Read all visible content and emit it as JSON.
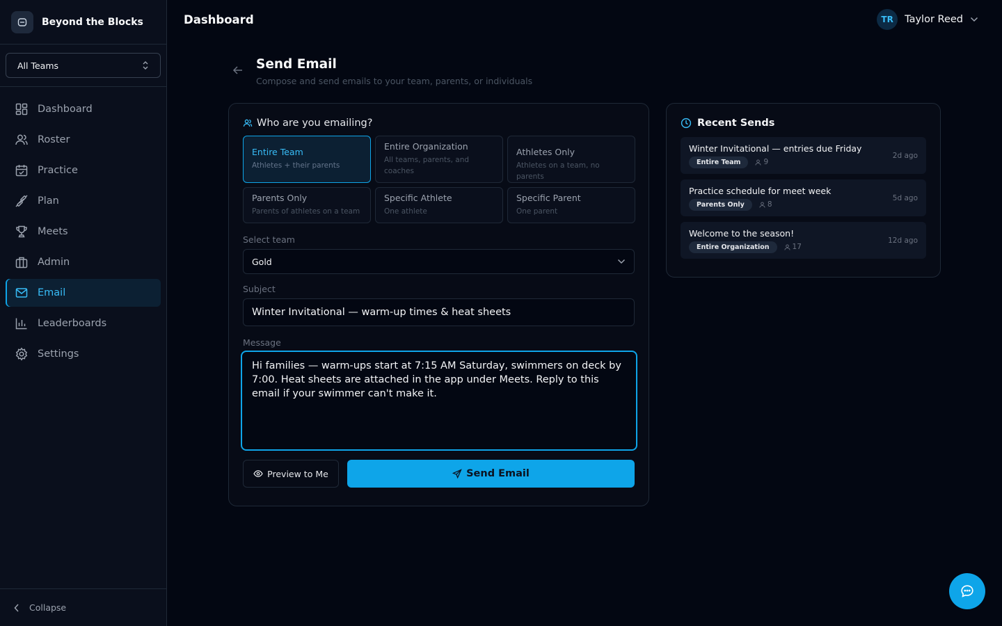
{
  "brand": {
    "name": "Beyond the Blocks"
  },
  "team_selector": {
    "value": "All Teams"
  },
  "sidebar": {
    "items": [
      {
        "label": "Dashboard",
        "icon": "dashboard-icon",
        "active": false
      },
      {
        "label": "Roster",
        "icon": "users-icon",
        "active": false
      },
      {
        "label": "Practice",
        "icon": "calendar-icon",
        "active": false
      },
      {
        "label": "Plan",
        "icon": "dumbbell-icon",
        "active": false
      },
      {
        "label": "Meets",
        "icon": "trophy-icon",
        "active": false
      },
      {
        "label": "Admin",
        "icon": "building-icon",
        "active": false
      },
      {
        "label": "Email",
        "icon": "mail-icon",
        "active": true
      },
      {
        "label": "Leaderboards",
        "icon": "bar-chart-icon",
        "active": false
      },
      {
        "label": "Settings",
        "icon": "gear-icon",
        "active": false
      }
    ],
    "collapse_label": "Collapse"
  },
  "header": {
    "title": "Dashboard",
    "user": {
      "initials": "TR",
      "name": "Taylor Reed"
    }
  },
  "page": {
    "title": "Send Email",
    "subtitle": "Compose and send emails to your team, parents, or individuals"
  },
  "compose": {
    "recipients_label": "Who are you emailing?",
    "options": [
      {
        "title": "Entire Team",
        "desc": "Athletes + their parents",
        "selected": true
      },
      {
        "title": "Entire Organization",
        "desc": "All teams, parents, and coaches",
        "selected": false
      },
      {
        "title": "Athletes Only",
        "desc": "Athletes on a team, no parents",
        "selected": false
      },
      {
        "title": "Parents Only",
        "desc": "Parents of athletes on a team",
        "selected": false
      },
      {
        "title": "Specific Athlete",
        "desc": "One athlete",
        "selected": false
      },
      {
        "title": "Specific Parent",
        "desc": "One parent",
        "selected": false
      }
    ],
    "team_label": "Select team",
    "team_value": "Gold",
    "subject_label": "Subject",
    "subject_value": "Winter Invitational — warm-up times & heat sheets",
    "message_label": "Message",
    "message_value": "Hi families — warm-ups start at 7:15 AM Saturday, swimmers on deck by 7:00. Heat sheets are attached in the app under Meets. Reply to this email if your swimmer can't make it.",
    "preview_label": "Preview to Me",
    "send_label": "Send Email"
  },
  "recent": {
    "title": "Recent Sends",
    "items": [
      {
        "title": "Winter Invitational — entries due Friday",
        "badge": "Entire Team",
        "count": "9",
        "time": "2d ago"
      },
      {
        "title": "Practice schedule for meet week",
        "badge": "Parents Only",
        "count": "8",
        "time": "5d ago"
      },
      {
        "title": "Welcome to the season!",
        "badge": "Entire Organization",
        "count": "17",
        "time": "12d ago"
      }
    ]
  },
  "colors": {
    "accent": "#0ea5e9",
    "background": "#030712",
    "panel": "#070b16"
  }
}
